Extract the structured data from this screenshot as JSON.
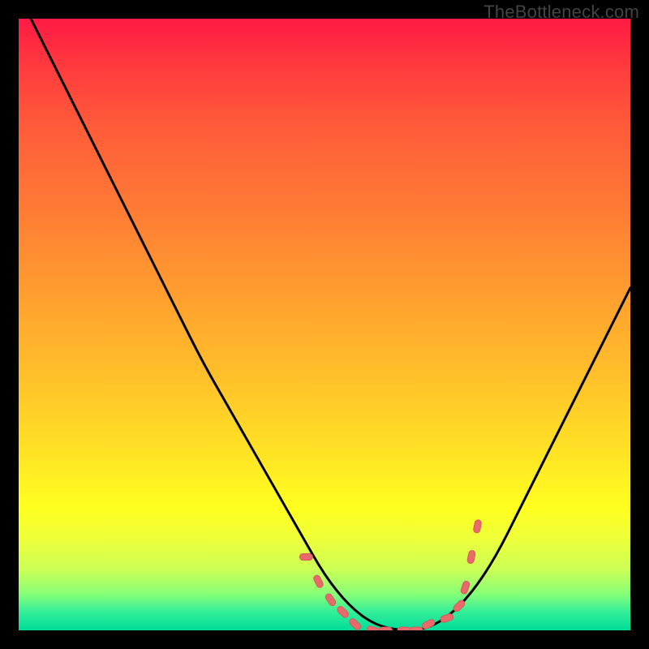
{
  "watermark": "TheBottleneck.com",
  "colors": {
    "curve": "#000000",
    "marker_fill": "#e86a6a",
    "marker_stroke": "#d95a5a",
    "frame_border": "#000000"
  },
  "chart_data": {
    "type": "line",
    "title": "",
    "xlabel": "",
    "ylabel": "",
    "xlim": [
      0,
      100
    ],
    "ylim": [
      0,
      100
    ],
    "grid": false,
    "series": [
      {
        "name": "bottleneck-curve",
        "x": [
          2,
          6,
          10,
          14,
          18,
          22,
          26,
          30,
          34,
          38,
          42,
          46,
          50,
          54,
          58,
          62,
          66,
          70,
          74,
          78,
          82,
          86,
          90,
          94,
          98,
          100
        ],
        "y": [
          100,
          92,
          84,
          76,
          68,
          60,
          52,
          44,
          37,
          30,
          23,
          16,
          9,
          4,
          1,
          0,
          0,
          2,
          6,
          12,
          20,
          28,
          36,
          44,
          52,
          56
        ]
      }
    ],
    "markers": {
      "name": "highlight-dots",
      "x": [
        47,
        49,
        51,
        53,
        55,
        58,
        60,
        63,
        65,
        67,
        70,
        72,
        73,
        74,
        75
      ],
      "y": [
        12,
        8,
        5,
        3,
        1,
        0,
        0,
        0,
        0,
        1,
        2,
        4,
        7,
        12,
        17
      ]
    }
  }
}
